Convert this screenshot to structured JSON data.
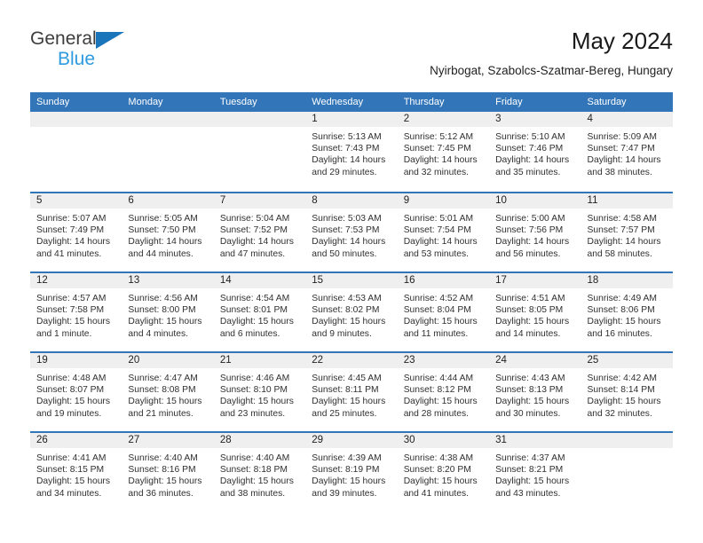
{
  "brand": {
    "name_top": "General",
    "name_bottom": "Blue",
    "triangle_color": "#1b75bb",
    "bottom_color": "#2e9bdf"
  },
  "header": {
    "title": "May 2024",
    "subtitle": "Nyirbogat, Szabolcs-Szatmar-Bereg, Hungary"
  },
  "theme": {
    "accent": "#3275b8",
    "daynum_band": "#efefef",
    "text": "#303030"
  },
  "weekdays": [
    "Sunday",
    "Monday",
    "Tuesday",
    "Wednesday",
    "Thursday",
    "Friday",
    "Saturday"
  ],
  "weeks": [
    [
      {
        "day": "",
        "lines": []
      },
      {
        "day": "",
        "lines": []
      },
      {
        "day": "",
        "lines": []
      },
      {
        "day": "1",
        "lines": [
          "Sunrise: 5:13 AM",
          "Sunset: 7:43 PM",
          "Daylight: 14 hours",
          "and 29 minutes."
        ]
      },
      {
        "day": "2",
        "lines": [
          "Sunrise: 5:12 AM",
          "Sunset: 7:45 PM",
          "Daylight: 14 hours",
          "and 32 minutes."
        ]
      },
      {
        "day": "3",
        "lines": [
          "Sunrise: 5:10 AM",
          "Sunset: 7:46 PM",
          "Daylight: 14 hours",
          "and 35 minutes."
        ]
      },
      {
        "day": "4",
        "lines": [
          "Sunrise: 5:09 AM",
          "Sunset: 7:47 PM",
          "Daylight: 14 hours",
          "and 38 minutes."
        ]
      }
    ],
    [
      {
        "day": "5",
        "lines": [
          "Sunrise: 5:07 AM",
          "Sunset: 7:49 PM",
          "Daylight: 14 hours",
          "and 41 minutes."
        ]
      },
      {
        "day": "6",
        "lines": [
          "Sunrise: 5:05 AM",
          "Sunset: 7:50 PM",
          "Daylight: 14 hours",
          "and 44 minutes."
        ]
      },
      {
        "day": "7",
        "lines": [
          "Sunrise: 5:04 AM",
          "Sunset: 7:52 PM",
          "Daylight: 14 hours",
          "and 47 minutes."
        ]
      },
      {
        "day": "8",
        "lines": [
          "Sunrise: 5:03 AM",
          "Sunset: 7:53 PM",
          "Daylight: 14 hours",
          "and 50 minutes."
        ]
      },
      {
        "day": "9",
        "lines": [
          "Sunrise: 5:01 AM",
          "Sunset: 7:54 PM",
          "Daylight: 14 hours",
          "and 53 minutes."
        ]
      },
      {
        "day": "10",
        "lines": [
          "Sunrise: 5:00 AM",
          "Sunset: 7:56 PM",
          "Daylight: 14 hours",
          "and 56 minutes."
        ]
      },
      {
        "day": "11",
        "lines": [
          "Sunrise: 4:58 AM",
          "Sunset: 7:57 PM",
          "Daylight: 14 hours",
          "and 58 minutes."
        ]
      }
    ],
    [
      {
        "day": "12",
        "lines": [
          "Sunrise: 4:57 AM",
          "Sunset: 7:58 PM",
          "Daylight: 15 hours",
          "and 1 minute."
        ]
      },
      {
        "day": "13",
        "lines": [
          "Sunrise: 4:56 AM",
          "Sunset: 8:00 PM",
          "Daylight: 15 hours",
          "and 4 minutes."
        ]
      },
      {
        "day": "14",
        "lines": [
          "Sunrise: 4:54 AM",
          "Sunset: 8:01 PM",
          "Daylight: 15 hours",
          "and 6 minutes."
        ]
      },
      {
        "day": "15",
        "lines": [
          "Sunrise: 4:53 AM",
          "Sunset: 8:02 PM",
          "Daylight: 15 hours",
          "and 9 minutes."
        ]
      },
      {
        "day": "16",
        "lines": [
          "Sunrise: 4:52 AM",
          "Sunset: 8:04 PM",
          "Daylight: 15 hours",
          "and 11 minutes."
        ]
      },
      {
        "day": "17",
        "lines": [
          "Sunrise: 4:51 AM",
          "Sunset: 8:05 PM",
          "Daylight: 15 hours",
          "and 14 minutes."
        ]
      },
      {
        "day": "18",
        "lines": [
          "Sunrise: 4:49 AM",
          "Sunset: 8:06 PM",
          "Daylight: 15 hours",
          "and 16 minutes."
        ]
      }
    ],
    [
      {
        "day": "19",
        "lines": [
          "Sunrise: 4:48 AM",
          "Sunset: 8:07 PM",
          "Daylight: 15 hours",
          "and 19 minutes."
        ]
      },
      {
        "day": "20",
        "lines": [
          "Sunrise: 4:47 AM",
          "Sunset: 8:08 PM",
          "Daylight: 15 hours",
          "and 21 minutes."
        ]
      },
      {
        "day": "21",
        "lines": [
          "Sunrise: 4:46 AM",
          "Sunset: 8:10 PM",
          "Daylight: 15 hours",
          "and 23 minutes."
        ]
      },
      {
        "day": "22",
        "lines": [
          "Sunrise: 4:45 AM",
          "Sunset: 8:11 PM",
          "Daylight: 15 hours",
          "and 25 minutes."
        ]
      },
      {
        "day": "23",
        "lines": [
          "Sunrise: 4:44 AM",
          "Sunset: 8:12 PM",
          "Daylight: 15 hours",
          "and 28 minutes."
        ]
      },
      {
        "day": "24",
        "lines": [
          "Sunrise: 4:43 AM",
          "Sunset: 8:13 PM",
          "Daylight: 15 hours",
          "and 30 minutes."
        ]
      },
      {
        "day": "25",
        "lines": [
          "Sunrise: 4:42 AM",
          "Sunset: 8:14 PM",
          "Daylight: 15 hours",
          "and 32 minutes."
        ]
      }
    ],
    [
      {
        "day": "26",
        "lines": [
          "Sunrise: 4:41 AM",
          "Sunset: 8:15 PM",
          "Daylight: 15 hours",
          "and 34 minutes."
        ]
      },
      {
        "day": "27",
        "lines": [
          "Sunrise: 4:40 AM",
          "Sunset: 8:16 PM",
          "Daylight: 15 hours",
          "and 36 minutes."
        ]
      },
      {
        "day": "28",
        "lines": [
          "Sunrise: 4:40 AM",
          "Sunset: 8:18 PM",
          "Daylight: 15 hours",
          "and 38 minutes."
        ]
      },
      {
        "day": "29",
        "lines": [
          "Sunrise: 4:39 AM",
          "Sunset: 8:19 PM",
          "Daylight: 15 hours",
          "and 39 minutes."
        ]
      },
      {
        "day": "30",
        "lines": [
          "Sunrise: 4:38 AM",
          "Sunset: 8:20 PM",
          "Daylight: 15 hours",
          "and 41 minutes."
        ]
      },
      {
        "day": "31",
        "lines": [
          "Sunrise: 4:37 AM",
          "Sunset: 8:21 PM",
          "Daylight: 15 hours",
          "and 43 minutes."
        ]
      },
      {
        "day": "",
        "lines": []
      }
    ]
  ]
}
